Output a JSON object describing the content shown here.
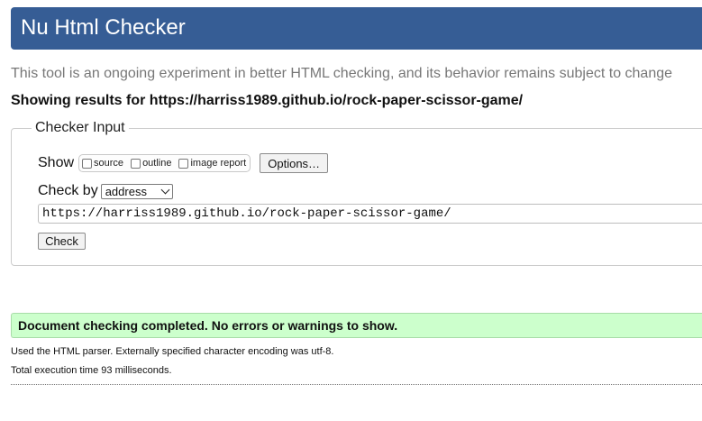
{
  "header": {
    "title": "Nu Html Checker"
  },
  "tagline": "This tool is an ongoing experiment in better HTML checking, and its behavior remains subject to change",
  "showing_results": "Showing results for https://harriss1989.github.io/rock-paper-scissor-game/",
  "checker_input": {
    "legend": "Checker Input",
    "show_label": "Show",
    "show_options": [
      {
        "label": "source",
        "checked": false
      },
      {
        "label": "outline",
        "checked": false
      },
      {
        "label": "image report",
        "checked": false
      }
    ],
    "options_button": "Options…",
    "check_by_label": "Check by",
    "check_by_value": "address",
    "url_value": "https://harriss1989.github.io/rock-paper-scissor-game/",
    "check_button": "Check"
  },
  "result": {
    "message": "Document checking completed. No errors or warnings to show.",
    "parser_info": "Used the HTML parser. Externally specified character encoding was utf-8.",
    "execution_time": "Total execution time 93 milliseconds."
  },
  "colors": {
    "header_bg": "#365d95",
    "success_bg": "#ccffcc"
  }
}
